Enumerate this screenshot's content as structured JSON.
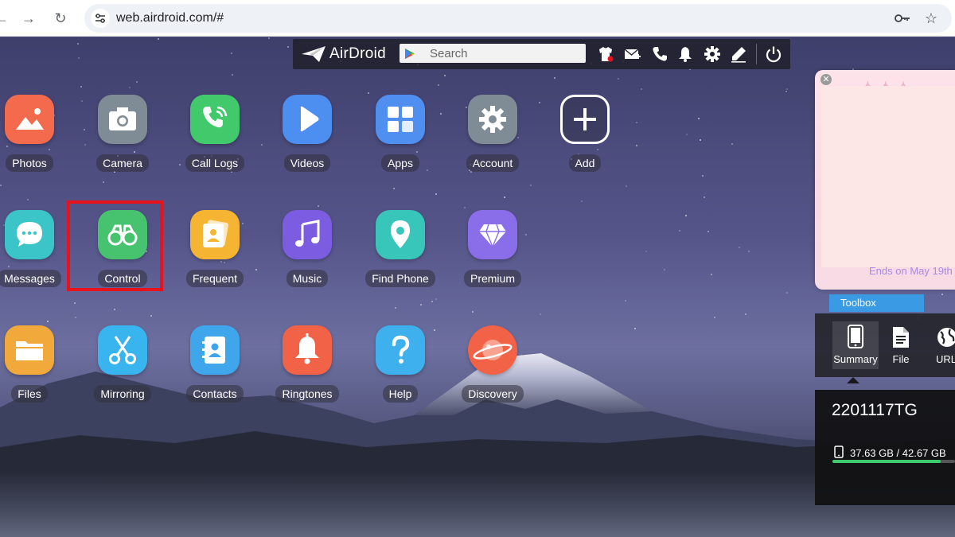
{
  "browser": {
    "url": "web.airdroid.com/#"
  },
  "topbar": {
    "logo_text": "AirDroid",
    "search_placeholder": "Search"
  },
  "apps": [
    {
      "label": "Photos",
      "icon": "photos-icon",
      "color": "#f36b4c"
    },
    {
      "label": "Camera",
      "icon": "camera-icon",
      "color": "#7f8c96"
    },
    {
      "label": "Call Logs",
      "icon": "call-logs-icon",
      "color": "#42c96b"
    },
    {
      "label": "Videos",
      "icon": "videos-icon",
      "color": "#4d8ff0"
    },
    {
      "label": "Apps",
      "icon": "apps-icon",
      "color": "#4f8ff0"
    },
    {
      "label": "Account",
      "icon": "account-gear-icon",
      "color": "#7f8c96"
    },
    {
      "label": "Add",
      "icon": "add-icon",
      "color": "transparent"
    },
    {
      "label": "Messages",
      "icon": "messages-icon",
      "color": "#3cc5c9"
    },
    {
      "label": "Control",
      "icon": "control-binoculars-icon",
      "color": "#47c26e"
    },
    {
      "label": "Frequent",
      "icon": "frequent-icon",
      "color": "#f5b532"
    },
    {
      "label": "Music",
      "icon": "music-icon",
      "color": "#7c5ce0"
    },
    {
      "label": "Find Phone",
      "icon": "find-phone-icon",
      "color": "#37c6b9"
    },
    {
      "label": "Premium",
      "icon": "premium-icon",
      "color": "#8a6de8"
    },
    {
      "label": "Files",
      "icon": "files-icon",
      "color": "#f2a93b"
    },
    {
      "label": "Mirroring",
      "icon": "mirroring-icon",
      "color": "#38b4ee"
    },
    {
      "label": "Contacts",
      "icon": "contacts-icon",
      "color": "#3fa6ec"
    },
    {
      "label": "Ringtones",
      "icon": "ringtones-icon",
      "color": "#f26247"
    },
    {
      "label": "Help",
      "icon": "help-icon",
      "color": "#3fb0ee"
    },
    {
      "label": "Discovery",
      "icon": "discovery-icon",
      "color": "#f26247"
    }
  ],
  "promo": {
    "footer_text": "Ends on May 19th"
  },
  "toolbox": {
    "tab_label": "Toolbox",
    "tools": [
      {
        "label": "Summary",
        "icon": "phone-summary-icon"
      },
      {
        "label": "File",
        "icon": "file-icon"
      },
      {
        "label": "URL",
        "icon": "globe-url-icon"
      }
    ]
  },
  "device": {
    "name": "2201117TG",
    "storage_text": "37.63 GB / 42.67 GB",
    "storage_used_fraction": 0.882
  },
  "colors": {
    "highlight_border": "#e8121d",
    "toolbox_tab": "#3a9be4",
    "storage_bar": "#3ecb6e"
  }
}
